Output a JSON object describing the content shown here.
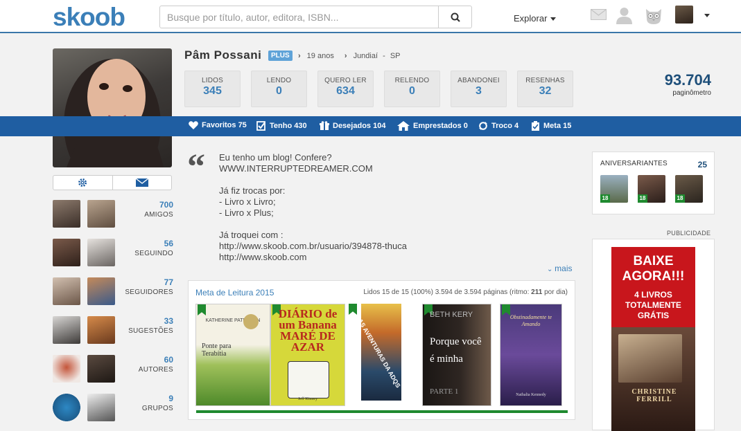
{
  "header": {
    "logo": "skoob",
    "search_placeholder": "Busque por título, autor, editora, ISBN...",
    "explorar": "Explorar"
  },
  "profile": {
    "name": "Pâm Possani",
    "badge": "PLUS",
    "age": "19 anos",
    "city": "Jundiaí",
    "state": "SP"
  },
  "stats": [
    {
      "label": "LIDOS",
      "value": "345"
    },
    {
      "label": "LENDO",
      "value": "0"
    },
    {
      "label": "QUERO LER",
      "value": "634"
    },
    {
      "label": "RELENDO",
      "value": "0"
    },
    {
      "label": "ABANDONEI",
      "value": "3"
    },
    {
      "label": "RESENHAS",
      "value": "32"
    }
  ],
  "paginometro": {
    "value": "93.704",
    "label": "paginômetro"
  },
  "bluebar": [
    {
      "label": "Favoritos 75",
      "icon": "heart-icon"
    },
    {
      "label": "Tenho 430",
      "icon": "checkbook-icon"
    },
    {
      "label": "Desejados 104",
      "icon": "gift-icon"
    },
    {
      "label": "Emprestados 0",
      "icon": "house-icon"
    },
    {
      "label": "Troco 4",
      "icon": "exchange-icon"
    },
    {
      "label": "Meta 15",
      "icon": "clipboard-icon"
    }
  ],
  "sidebar": [
    {
      "count": "700",
      "label": "AMIGOS"
    },
    {
      "count": "56",
      "label": "SEGUINDO"
    },
    {
      "count": "77",
      "label": "SEGUIDORES"
    },
    {
      "count": "33",
      "label": "SUGESTÕES"
    },
    {
      "count": "60",
      "label": "AUTORES"
    },
    {
      "count": "9",
      "label": "GRUPOS"
    }
  ],
  "bio": {
    "text": "Eu tenho um blog! Confere?\nWWW.INTERRUPTEDREAMER.COM\n\nJá fiz trocas por:\n- Livro x Livro;\n- Livro x Plus;\n\nJá troquei com :\nhttp://www.skoob.com.br/usuario/394878-thuca\nhttp://www.skoob.com",
    "more": "mais"
  },
  "meta_leitura": {
    "title": "Meta de Leitura 2015",
    "info_prefix": "Lidos 15 de 15 (100%) 3.594 de 3.594 páginas (ritmo: ",
    "ritmo": "211",
    "info_suffix": " por dia)",
    "progress": 1.0,
    "books": [
      {
        "title": "Ponte para Terabítia",
        "author": "KATHERINE PATERSON"
      },
      {
        "title": "DIÁRIO de um Banana MARÉ DE AZAR",
        "author": "Jeff Kinney"
      },
      {
        "title": "AS AVENTURAS DA ADQS",
        "author": ""
      },
      {
        "title": "Porque você é minha",
        "author": "BETH KERY",
        "sub": "PARTE 1"
      },
      {
        "title": "Obstinadamente te Amando",
        "author": "Nathalia Kennedy"
      }
    ]
  },
  "aniversariantes": {
    "label": "ANIVERSARIANTES",
    "count": "25",
    "ages": [
      "18",
      "18",
      "18"
    ]
  },
  "publicidade": {
    "label": "PUBLICIDADE",
    "line1": "BAIXE AGORA!!!",
    "line2": "4 LIVROS TOTALMENTE GRÁTIS",
    "book_author": "CHRISTINE FERRILL"
  }
}
